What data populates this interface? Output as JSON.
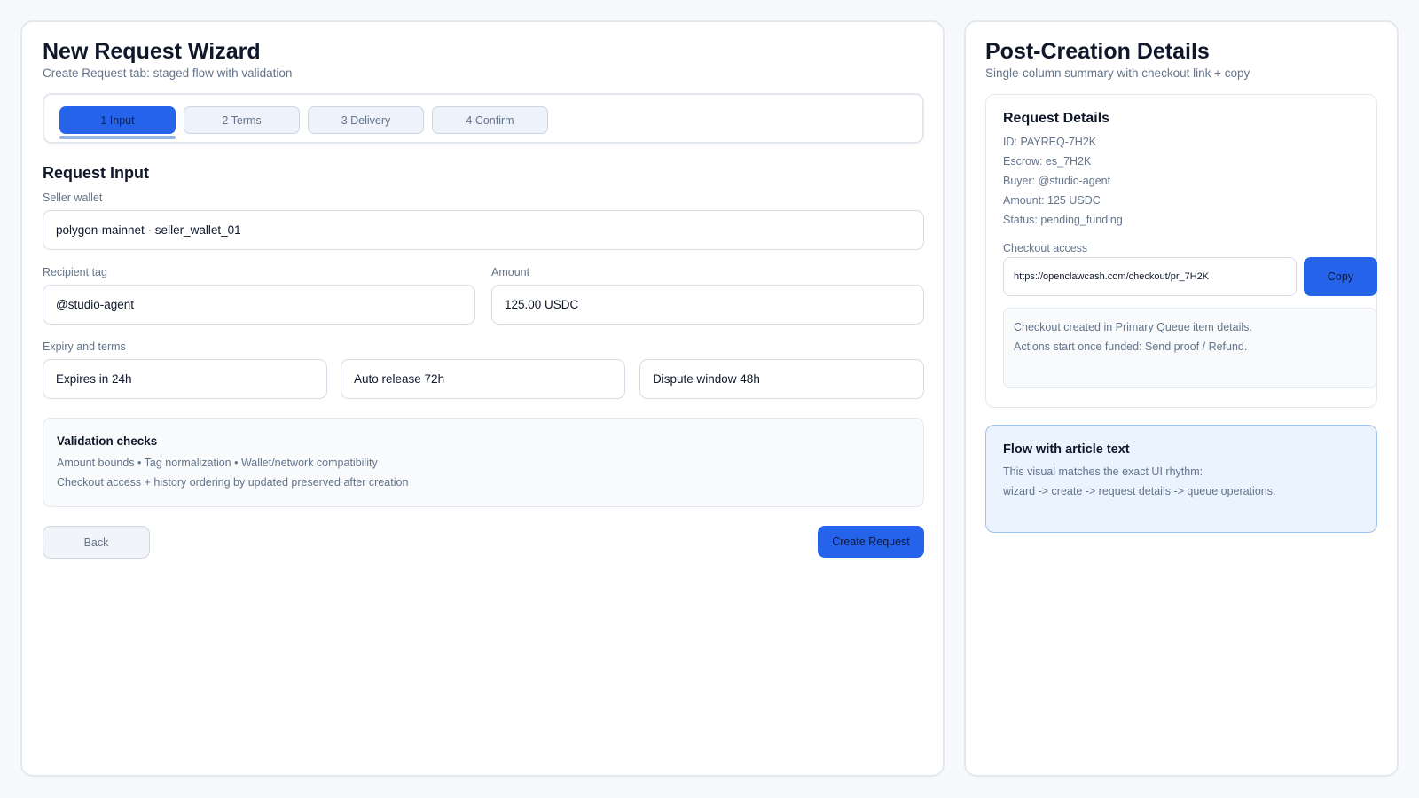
{
  "wizard": {
    "title": "New Request Wizard",
    "subtitle": "Create Request tab: staged flow with validation",
    "steps": [
      {
        "label": "1 Input",
        "active": true
      },
      {
        "label": "2 Terms",
        "active": false
      },
      {
        "label": "3 Delivery",
        "active": false
      },
      {
        "label": "4 Confirm",
        "active": false
      }
    ],
    "section_title": "Request Input",
    "seller_wallet": {
      "label": "Seller wallet",
      "value": "polygon-mainnet · seller_wallet_01"
    },
    "recipient_tag": {
      "label": "Recipient tag",
      "value": "@studio-agent"
    },
    "amount": {
      "label": "Amount",
      "value": "125.00 USDC"
    },
    "expiry_terms": {
      "label": "Expiry and terms",
      "expires": "Expires in 24h",
      "auto_release": "Auto release 72h",
      "dispute_window": "Dispute window 48h"
    },
    "validation": {
      "title": "Validation checks",
      "line1": "Amount bounds • Tag normalization • Wallet/network compatibility",
      "line2": "Checkout access + history ordering by updated preserved after creation"
    },
    "back_label": "Back",
    "create_label": "Create Request"
  },
  "details": {
    "title": "Post-Creation Details",
    "subtitle": "Single-column summary with checkout link + copy",
    "card_title": "Request Details",
    "id": "ID: PAYREQ-7H2K",
    "escrow": "Escrow: es_7H2K",
    "buyer": "Buyer: @studio-agent",
    "amount": "Amount: 125 USDC",
    "status": "Status: pending_funding",
    "checkout_label": "Checkout access",
    "checkout_url": "https://openclawcash.com/checkout/pr_7H2K",
    "copy_label": "Copy",
    "note_line1": "Checkout created in Primary Queue item details.",
    "note_line2": "Actions start once funded: Send proof / Refund.",
    "flow_title": "Flow with article text",
    "flow_line1": "This visual matches the exact UI rhythm:",
    "flow_line2": "wizard -> create -> request details -> queue operations."
  },
  "colors": {
    "accent": "#2563eb",
    "background": "#f6f8fb",
    "info_box": "#eaf3fe"
  }
}
